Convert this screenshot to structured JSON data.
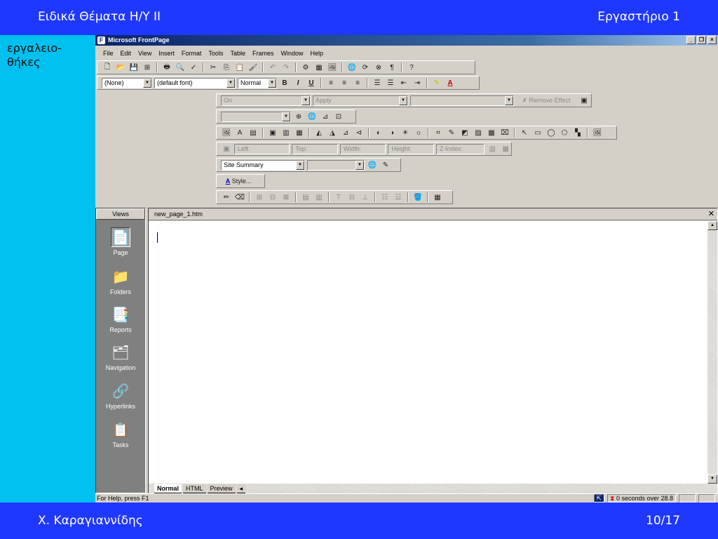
{
  "slide": {
    "course_title": "Ειδικά Θέματα Η/Υ ΙΙ",
    "lab_label": "Εργαστήριο 1",
    "side_note_line1": "εργαλειο-",
    "side_note_line2": "θήκες",
    "author": "Χ. Καραγιαννίδης",
    "page": "10/17"
  },
  "window": {
    "title": "Microsoft FrontPage",
    "controls": [
      "_",
      "❐",
      "×"
    ]
  },
  "menu": [
    "File",
    "Edit",
    "View",
    "Insert",
    "Format",
    "Tools",
    "Table",
    "Frames",
    "Window",
    "Help"
  ],
  "formatting": {
    "style": "(None)",
    "font": "(default font)",
    "size": "Normal",
    "bold": "B",
    "italic": "I",
    "underline": "U"
  },
  "dhtml": {
    "on": "On",
    "apply": "Apply",
    "remove_effect": "Remove Effect"
  },
  "positioning": {
    "left": "Left:",
    "top": "Top:",
    "width": "Width:",
    "height": "Height:",
    "zindex": "Z-Index:"
  },
  "reports": {
    "select": "Site Summary"
  },
  "style_toolbar": {
    "label": "Style..."
  },
  "views": {
    "header": "Views",
    "items": [
      "Page",
      "Folders",
      "Reports",
      "Navigation",
      "Hyperlinks",
      "Tasks"
    ]
  },
  "editor": {
    "filename": "new_page_1.htm",
    "tabs": [
      "Normal",
      "HTML",
      "Preview"
    ]
  },
  "status": {
    "help": "For Help, press F1",
    "timing": "0 seconds over 28.8"
  }
}
